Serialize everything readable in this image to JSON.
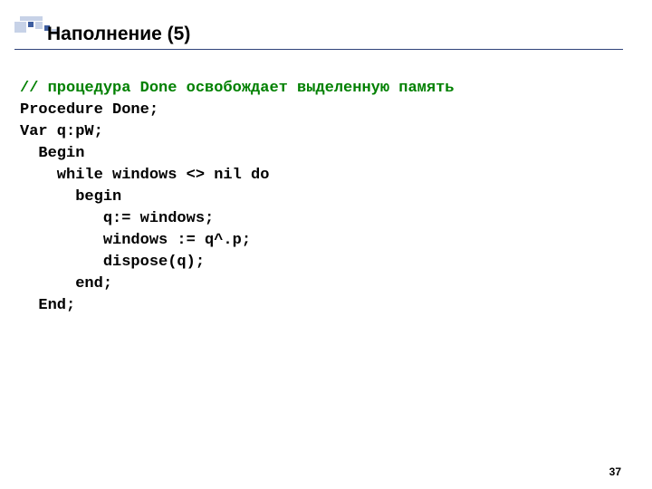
{
  "title": "Наполнение (5)",
  "code": {
    "comment": "// процедура Done освобождает выделенную память",
    "l1": "Procedure Done;",
    "l2": "Var q:pW;",
    "l3": "  Begin",
    "l4": "    while windows <> nil do",
    "l5": "      begin",
    "l6": "         q:= windows;",
    "l7": "         windows := q^.p;",
    "l8": "         dispose(q);",
    "l9": "      end;",
    "l10": "  End;"
  },
  "page_number": "37"
}
